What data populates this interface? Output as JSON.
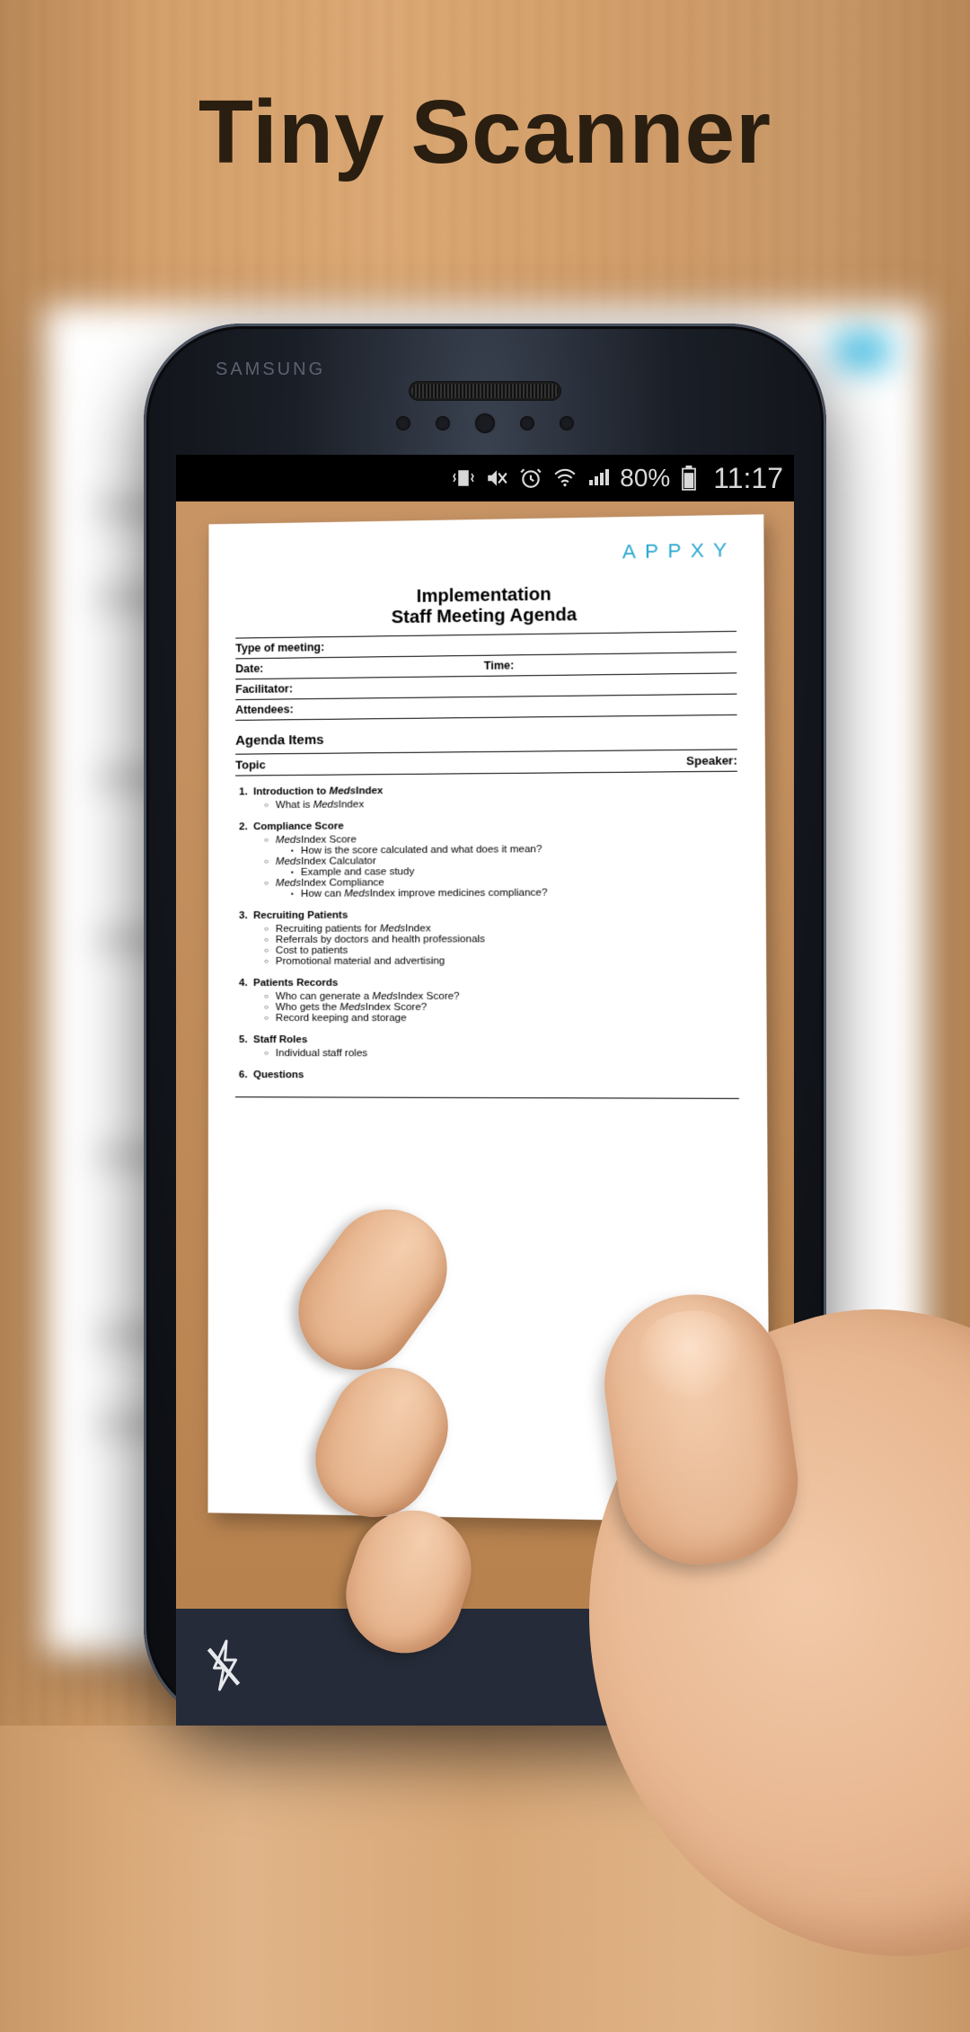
{
  "promo": {
    "title": "Tiny Scanner"
  },
  "statusbar": {
    "battery_pct": "80%",
    "clock": "11:17",
    "icons": [
      "vibrate",
      "mute",
      "alarm",
      "wifi",
      "signal",
      "battery"
    ]
  },
  "toolbar": {
    "flash": "flash-off"
  },
  "document": {
    "brand": "APPXY",
    "title": "Implementation",
    "subtitle": "Staff Meeting Agenda",
    "fields": {
      "type_of_meeting": "Type of meeting:",
      "date": "Date:",
      "time": "Time:",
      "facilitator": "Facilitator:",
      "attendees": "Attendees:"
    },
    "agenda_header": "Agenda Items",
    "columns": {
      "topic": "Topic",
      "speaker": "Speaker:"
    },
    "items": [
      {
        "num": "1.",
        "title": "Introduction to MedsIndex",
        "title_em": "Meds",
        "subs": [
          {
            "text": "What is MedsIndex"
          }
        ]
      },
      {
        "num": "2.",
        "title": "Compliance Score",
        "subs": [
          {
            "text": "MedsIndex Score",
            "subsubs": [
              "How is the score calculated and what does it mean?"
            ]
          },
          {
            "text": "MedsIndex Calculator",
            "subsubs": [
              "Example and case study"
            ]
          },
          {
            "text": "MedsIndex Compliance",
            "subsubs": [
              "How can MedsIndex improve medicines compliance?"
            ]
          }
        ]
      },
      {
        "num": "3.",
        "title": "Recruiting Patients",
        "subs": [
          {
            "text": "Recruiting patients for MedsIndex"
          },
          {
            "text": "Referrals by doctors and health professionals"
          },
          {
            "text": "Cost to patients"
          },
          {
            "text": "Promotional material and advertising"
          }
        ]
      },
      {
        "num": "4.",
        "title": "Patients Records",
        "subs": [
          {
            "text": "Who can generate a MedsIndex Score?"
          },
          {
            "text": "Who gets the MedsIndex Score?"
          },
          {
            "text": "Record keeping and storage"
          }
        ]
      },
      {
        "num": "5.",
        "title": "Staff Roles",
        "subs": [
          {
            "text": "Individual staff roles"
          }
        ]
      },
      {
        "num": "6.",
        "title": "Questions",
        "subs": []
      }
    ]
  }
}
